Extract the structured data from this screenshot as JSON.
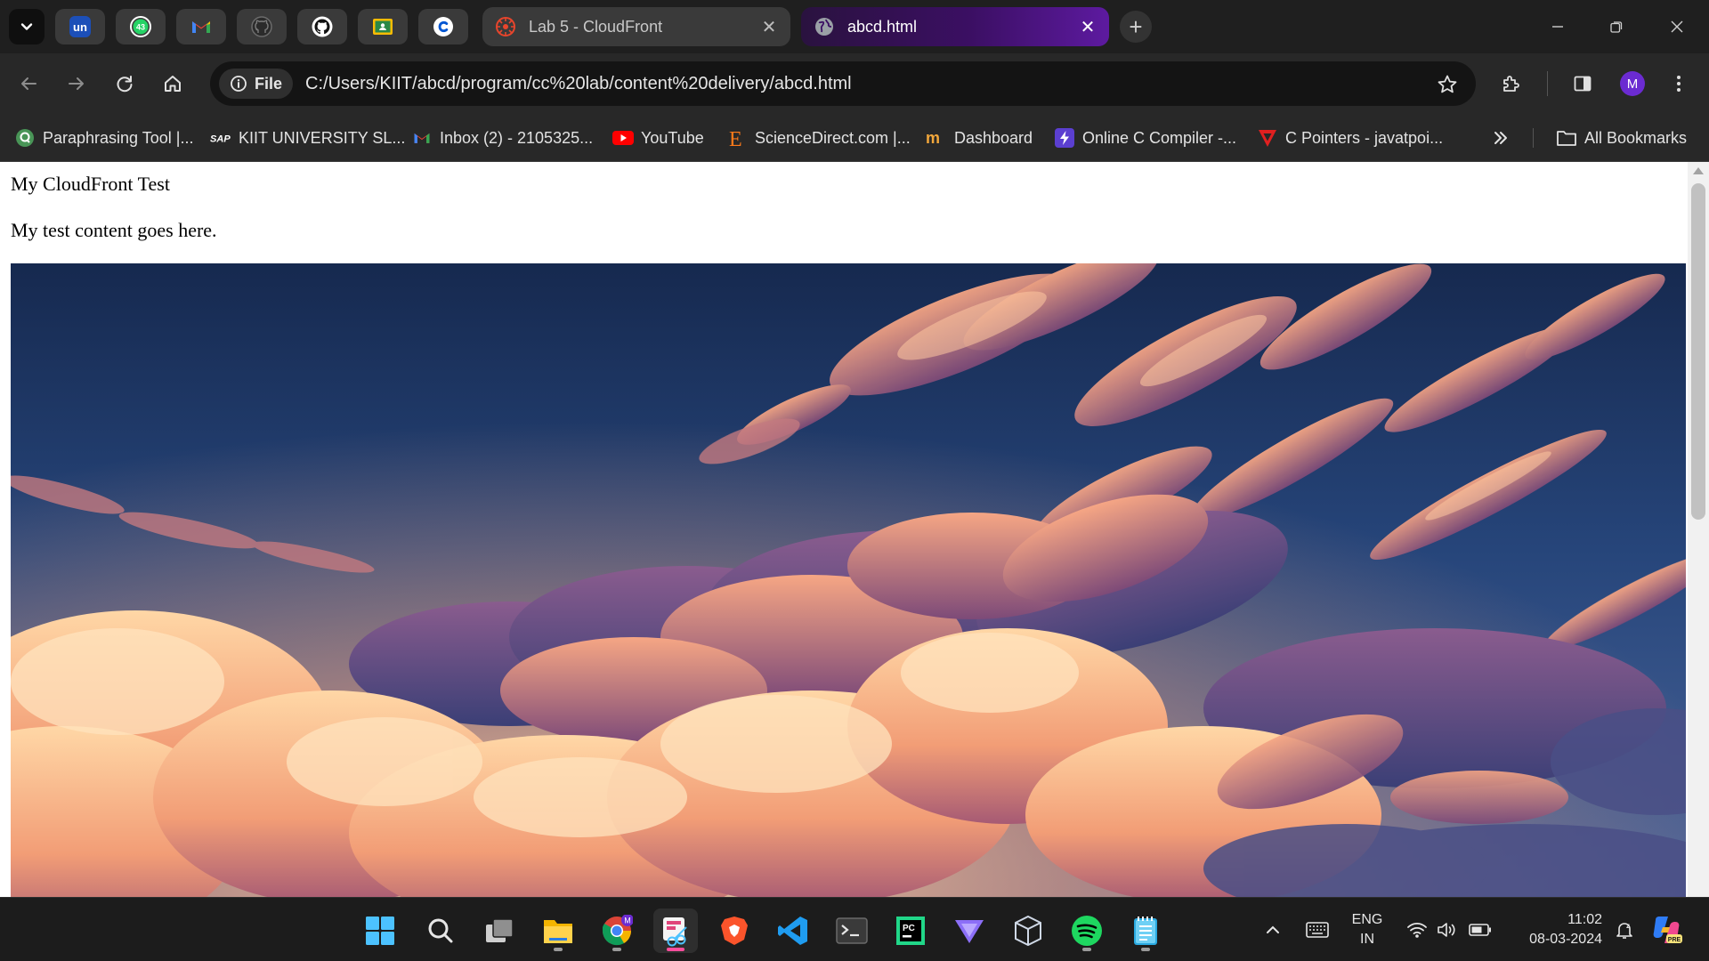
{
  "tabs": {
    "pinned": [
      {
        "name": "unstop",
        "badge": "un"
      },
      {
        "name": "whatsapp",
        "badge": "43"
      },
      {
        "name": "gmail"
      },
      {
        "name": "github"
      },
      {
        "name": "github"
      },
      {
        "name": "google-classroom"
      },
      {
        "name": "coursera"
      }
    ],
    "inactive": {
      "title": "Lab 5 - CloudFront"
    },
    "active": {
      "title": "abcd.html"
    }
  },
  "toolbar": {
    "chip_label": "File",
    "url": "C:/Users/KIIT/abcd/program/cc%20lab/content%20delivery/abcd.html",
    "avatar_letter": "M"
  },
  "bookmarks": {
    "items": [
      {
        "label": "Paraphrasing Tool |..."
      },
      {
        "label": "KIIT UNIVERSITY SL..."
      },
      {
        "label": "Inbox (2) - 2105325..."
      },
      {
        "label": "YouTube"
      },
      {
        "label": "ScienceDirect.com |..."
      },
      {
        "label": "Dashboard"
      },
      {
        "label": "Online C Compiler -..."
      },
      {
        "label": "C Pointers - javatpoi..."
      }
    ],
    "all_label": "All Bookmarks"
  },
  "page": {
    "title": "My CloudFront Test",
    "text": "My test content goes here."
  },
  "taskbar": {
    "lang_line1": "ENG",
    "lang_line2": "IN",
    "time": "11:02",
    "date": "08-03-2024",
    "chrome_badge": "M"
  },
  "colors": {
    "active_tab": "#5d1aa0",
    "tabstrip": "#1f1f1f",
    "toolbar": "#282828",
    "page_bg": "#ffffff"
  }
}
